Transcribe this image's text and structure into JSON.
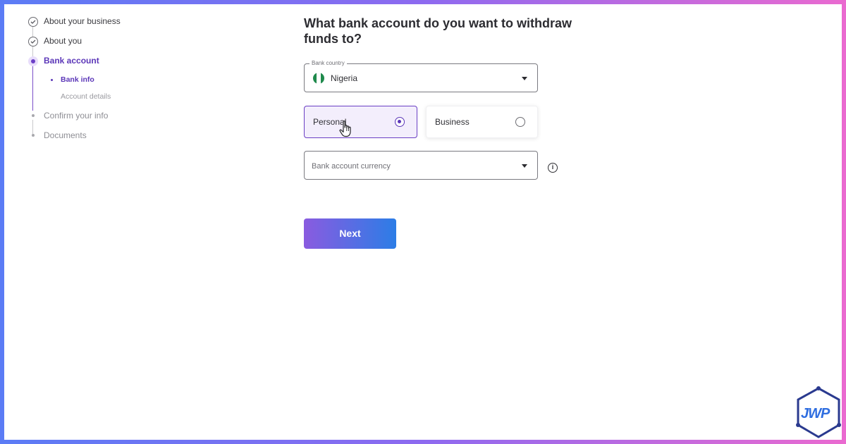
{
  "stepper": {
    "steps": [
      {
        "label": "About your business",
        "state": "done"
      },
      {
        "label": "About you",
        "state": "done"
      },
      {
        "label": "Bank account",
        "state": "active"
      },
      {
        "label": "Confirm your info",
        "state": "pending"
      },
      {
        "label": "Documents",
        "state": "pending"
      }
    ],
    "substeps": [
      {
        "label": "Bank info",
        "state": "active"
      },
      {
        "label": "Account details",
        "state": "pending"
      }
    ]
  },
  "form": {
    "title": "What bank account do you want to withdraw funds to?",
    "bank_country": {
      "legend": "Bank country",
      "value": "Nigeria",
      "flag_icon": "nigeria-flag-icon",
      "flag_colors": [
        "#1f8a4c",
        "#ffffff",
        "#1f8a4c"
      ]
    },
    "account_type": {
      "options": [
        {
          "label": "Personal",
          "selected": true
        },
        {
          "label": "Business",
          "selected": false
        }
      ]
    },
    "currency": {
      "placeholder": "Bank account currency"
    },
    "info_icon": "i",
    "next_label": "Next"
  },
  "colors": {
    "accent_purple": "#5b36b8",
    "button_gradient_start": "#8a5be0",
    "button_gradient_end": "#2c7de6",
    "frame_gradient_start": "#5b7cf5",
    "frame_gradient_end": "#ea6ad0"
  },
  "watermark": {
    "text": "JWP"
  }
}
